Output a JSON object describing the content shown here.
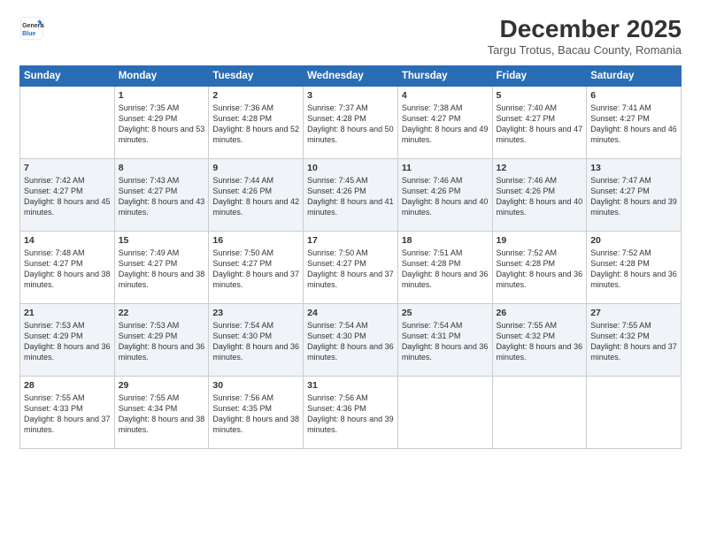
{
  "logo": {
    "line1": "General",
    "line2": "Blue"
  },
  "title": "December 2025",
  "subtitle": "Targu Trotus, Bacau County, Romania",
  "weekdays": [
    "Sunday",
    "Monday",
    "Tuesday",
    "Wednesday",
    "Thursday",
    "Friday",
    "Saturday"
  ],
  "weeks": [
    [
      {
        "day": "",
        "sunrise": "",
        "sunset": "",
        "daylight": ""
      },
      {
        "day": "1",
        "sunrise": "Sunrise: 7:35 AM",
        "sunset": "Sunset: 4:29 PM",
        "daylight": "Daylight: 8 hours and 53 minutes."
      },
      {
        "day": "2",
        "sunrise": "Sunrise: 7:36 AM",
        "sunset": "Sunset: 4:28 PM",
        "daylight": "Daylight: 8 hours and 52 minutes."
      },
      {
        "day": "3",
        "sunrise": "Sunrise: 7:37 AM",
        "sunset": "Sunset: 4:28 PM",
        "daylight": "Daylight: 8 hours and 50 minutes."
      },
      {
        "day": "4",
        "sunrise": "Sunrise: 7:38 AM",
        "sunset": "Sunset: 4:27 PM",
        "daylight": "Daylight: 8 hours and 49 minutes."
      },
      {
        "day": "5",
        "sunrise": "Sunrise: 7:40 AM",
        "sunset": "Sunset: 4:27 PM",
        "daylight": "Daylight: 8 hours and 47 minutes."
      },
      {
        "day": "6",
        "sunrise": "Sunrise: 7:41 AM",
        "sunset": "Sunset: 4:27 PM",
        "daylight": "Daylight: 8 hours and 46 minutes."
      }
    ],
    [
      {
        "day": "7",
        "sunrise": "Sunrise: 7:42 AM",
        "sunset": "Sunset: 4:27 PM",
        "daylight": "Daylight: 8 hours and 45 minutes."
      },
      {
        "day": "8",
        "sunrise": "Sunrise: 7:43 AM",
        "sunset": "Sunset: 4:27 PM",
        "daylight": "Daylight: 8 hours and 43 minutes."
      },
      {
        "day": "9",
        "sunrise": "Sunrise: 7:44 AM",
        "sunset": "Sunset: 4:26 PM",
        "daylight": "Daylight: 8 hours and 42 minutes."
      },
      {
        "day": "10",
        "sunrise": "Sunrise: 7:45 AM",
        "sunset": "Sunset: 4:26 PM",
        "daylight": "Daylight: 8 hours and 41 minutes."
      },
      {
        "day": "11",
        "sunrise": "Sunrise: 7:46 AM",
        "sunset": "Sunset: 4:26 PM",
        "daylight": "Daylight: 8 hours and 40 minutes."
      },
      {
        "day": "12",
        "sunrise": "Sunrise: 7:46 AM",
        "sunset": "Sunset: 4:26 PM",
        "daylight": "Daylight: 8 hours and 40 minutes."
      },
      {
        "day": "13",
        "sunrise": "Sunrise: 7:47 AM",
        "sunset": "Sunset: 4:27 PM",
        "daylight": "Daylight: 8 hours and 39 minutes."
      }
    ],
    [
      {
        "day": "14",
        "sunrise": "Sunrise: 7:48 AM",
        "sunset": "Sunset: 4:27 PM",
        "daylight": "Daylight: 8 hours and 38 minutes."
      },
      {
        "day": "15",
        "sunrise": "Sunrise: 7:49 AM",
        "sunset": "Sunset: 4:27 PM",
        "daylight": "Daylight: 8 hours and 38 minutes."
      },
      {
        "day": "16",
        "sunrise": "Sunrise: 7:50 AM",
        "sunset": "Sunset: 4:27 PM",
        "daylight": "Daylight: 8 hours and 37 minutes."
      },
      {
        "day": "17",
        "sunrise": "Sunrise: 7:50 AM",
        "sunset": "Sunset: 4:27 PM",
        "daylight": "Daylight: 8 hours and 37 minutes."
      },
      {
        "day": "18",
        "sunrise": "Sunrise: 7:51 AM",
        "sunset": "Sunset: 4:28 PM",
        "daylight": "Daylight: 8 hours and 36 minutes."
      },
      {
        "day": "19",
        "sunrise": "Sunrise: 7:52 AM",
        "sunset": "Sunset: 4:28 PM",
        "daylight": "Daylight: 8 hours and 36 minutes."
      },
      {
        "day": "20",
        "sunrise": "Sunrise: 7:52 AM",
        "sunset": "Sunset: 4:28 PM",
        "daylight": "Daylight: 8 hours and 36 minutes."
      }
    ],
    [
      {
        "day": "21",
        "sunrise": "Sunrise: 7:53 AM",
        "sunset": "Sunset: 4:29 PM",
        "daylight": "Daylight: 8 hours and 36 minutes."
      },
      {
        "day": "22",
        "sunrise": "Sunrise: 7:53 AM",
        "sunset": "Sunset: 4:29 PM",
        "daylight": "Daylight: 8 hours and 36 minutes."
      },
      {
        "day": "23",
        "sunrise": "Sunrise: 7:54 AM",
        "sunset": "Sunset: 4:30 PM",
        "daylight": "Daylight: 8 hours and 36 minutes."
      },
      {
        "day": "24",
        "sunrise": "Sunrise: 7:54 AM",
        "sunset": "Sunset: 4:30 PM",
        "daylight": "Daylight: 8 hours and 36 minutes."
      },
      {
        "day": "25",
        "sunrise": "Sunrise: 7:54 AM",
        "sunset": "Sunset: 4:31 PM",
        "daylight": "Daylight: 8 hours and 36 minutes."
      },
      {
        "day": "26",
        "sunrise": "Sunrise: 7:55 AM",
        "sunset": "Sunset: 4:32 PM",
        "daylight": "Daylight: 8 hours and 36 minutes."
      },
      {
        "day": "27",
        "sunrise": "Sunrise: 7:55 AM",
        "sunset": "Sunset: 4:32 PM",
        "daylight": "Daylight: 8 hours and 37 minutes."
      }
    ],
    [
      {
        "day": "28",
        "sunrise": "Sunrise: 7:55 AM",
        "sunset": "Sunset: 4:33 PM",
        "daylight": "Daylight: 8 hours and 37 minutes."
      },
      {
        "day": "29",
        "sunrise": "Sunrise: 7:55 AM",
        "sunset": "Sunset: 4:34 PM",
        "daylight": "Daylight: 8 hours and 38 minutes."
      },
      {
        "day": "30",
        "sunrise": "Sunrise: 7:56 AM",
        "sunset": "Sunset: 4:35 PM",
        "daylight": "Daylight: 8 hours and 38 minutes."
      },
      {
        "day": "31",
        "sunrise": "Sunrise: 7:56 AM",
        "sunset": "Sunset: 4:36 PM",
        "daylight": "Daylight: 8 hours and 39 minutes."
      },
      {
        "day": "",
        "sunrise": "",
        "sunset": "",
        "daylight": ""
      },
      {
        "day": "",
        "sunrise": "",
        "sunset": "",
        "daylight": ""
      },
      {
        "day": "",
        "sunrise": "",
        "sunset": "",
        "daylight": ""
      }
    ]
  ]
}
